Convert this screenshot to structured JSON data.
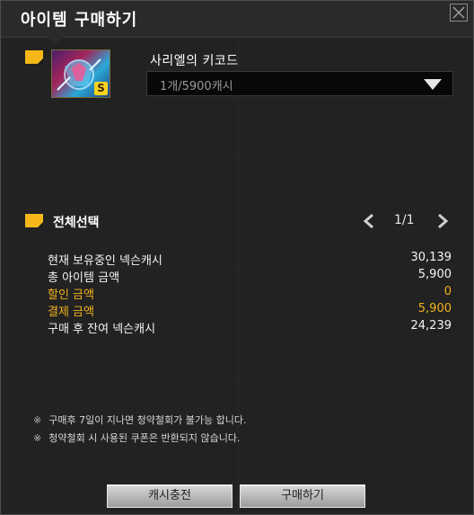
{
  "window": {
    "title": "아이템 구매하기"
  },
  "item": {
    "name": "사리엘의 키코드",
    "badge": "S",
    "selected_option": "1개/5900캐시"
  },
  "select_all": {
    "label": "전체선택"
  },
  "pager": {
    "text": "1/1"
  },
  "summary": {
    "rows": [
      {
        "label": "현재 보유중인 넥슨캐시",
        "value": "30,139"
      },
      {
        "label": "총 아이템 금액",
        "value": "5,900"
      },
      {
        "label": "할인 금액",
        "value": "0"
      },
      {
        "label": "결제 금액",
        "value": "5,900"
      },
      {
        "label": "구매 후 잔여 넥슨캐시",
        "value": "24,239"
      }
    ]
  },
  "notes": {
    "marker": "※",
    "items": [
      "구매후 7일이 지나면 청약철회가 불가능 합니다.",
      "청약철회 시 사용된 쿠폰은 반환되지 않습니다."
    ]
  },
  "buttons": {
    "recharge": "캐시충전",
    "buy": "구매하기"
  },
  "colors": {
    "accent": "#f5b818",
    "highlight_text": "#f2b21c",
    "background": "#222222"
  }
}
